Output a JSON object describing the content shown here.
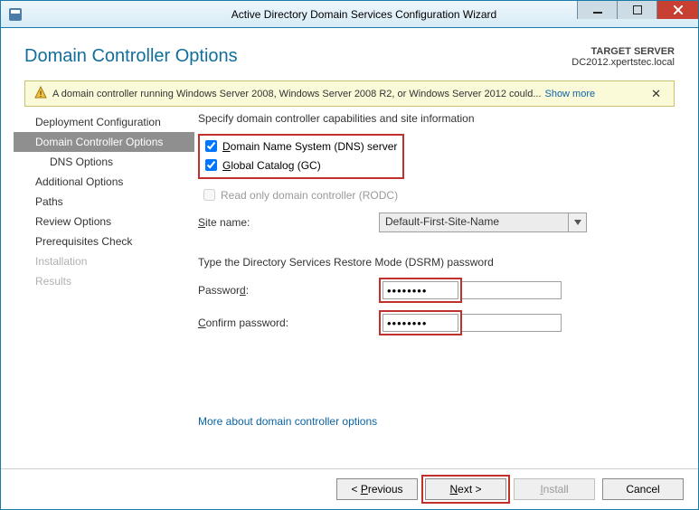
{
  "titlebar": {
    "title": "Active Directory Domain Services Configuration Wizard"
  },
  "header": {
    "page_title": "Domain Controller Options",
    "target_label": "TARGET SERVER",
    "target_server": "DC2012.xpertstec.local"
  },
  "warning": {
    "text": "A domain controller running Windows Server 2008, Windows Server 2008 R2, or Windows Server 2012 could...",
    "link": "Show more"
  },
  "sidebar": {
    "items": [
      {
        "label": "Deployment Configuration"
      },
      {
        "label": "Domain Controller Options"
      },
      {
        "label": "DNS Options"
      },
      {
        "label": "Additional Options"
      },
      {
        "label": "Paths"
      },
      {
        "label": "Review Options"
      },
      {
        "label": "Prerequisites Check"
      },
      {
        "label": "Installation"
      },
      {
        "label": "Results"
      }
    ]
  },
  "main": {
    "caps_heading": "Specify domain controller capabilities and site information",
    "dns_prefix": "D",
    "dns_rest": "omain Name System (DNS) server",
    "gc_prefix": "G",
    "gc_rest": "lobal Catalog (GC)",
    "rodc_prefix": "R",
    "rodc_rest": "ead only domain controller (RODC)",
    "site_label_prefix": "S",
    "site_label_rest": "ite name:",
    "site_value": "Default-First-Site-Name",
    "dsrm_heading": "Type the Directory Services Restore Mode (DSRM) password",
    "pw_label_prefix": "Passwor",
    "pw_label_u": "d",
    "pw_label_rest": ":",
    "pw_confirm_prefix": "C",
    "pw_confirm_rest": "onfirm password:",
    "pw_value": "••••••••",
    "pw_confirm_value": "••••••••",
    "more_link": "More about domain controller options"
  },
  "footer": {
    "previous_pre": "< ",
    "previous_u": "P",
    "previous_rest": "revious",
    "next_u": "N",
    "next_rest": "ext >",
    "install_u": "I",
    "install_rest": "nstall",
    "cancel": "Cancel"
  }
}
